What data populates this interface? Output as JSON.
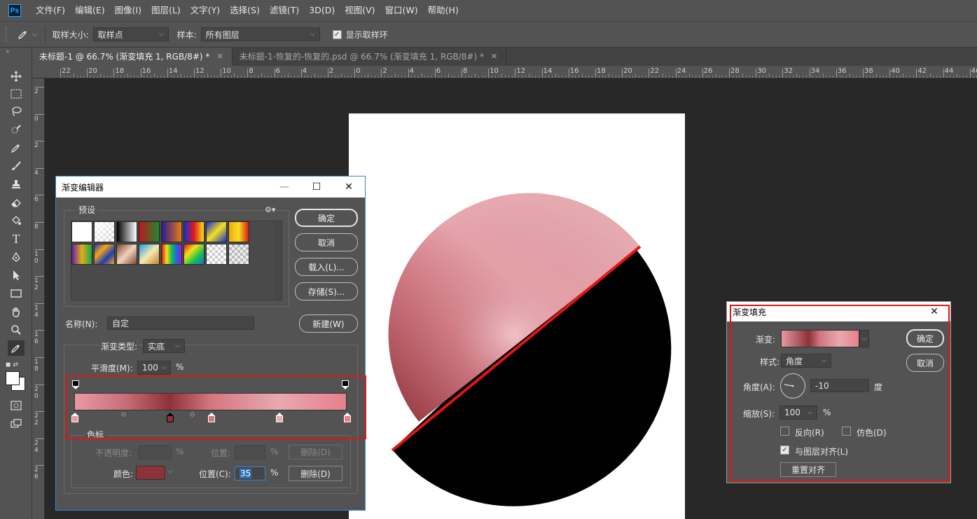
{
  "app": {
    "logo": "Ps"
  },
  "menu": [
    "文件(F)",
    "编辑(E)",
    "图像(I)",
    "图层(L)",
    "文字(Y)",
    "选择(S)",
    "滤镜(T)",
    "3D(D)",
    "视图(V)",
    "窗口(W)",
    "帮助(H)"
  ],
  "options": {
    "sample_size_label": "取样大小:",
    "sample_size_value": "取样点",
    "sample_label": "样本:",
    "sample_value": "所有图层",
    "show_ring_label": "显示取样环",
    "show_ring_checked": true
  },
  "tabs": [
    {
      "label": "未标题-1 @ 66.7% (渐变填充 1, RGB/8#) *",
      "active": true
    },
    {
      "label": "未标题-1-恢复的-恢复的.psd @ 66.7% (渐变填充 1, RGB/8#) *",
      "active": false
    }
  ],
  "ruler_top": [
    "22",
    "20",
    "18",
    "16",
    "14",
    "12",
    "10",
    "8",
    "6",
    "4",
    "2",
    "0",
    "2",
    "4",
    "6",
    "8",
    "10",
    "12",
    "14",
    "16",
    "18",
    "20",
    "22",
    "24",
    "26",
    "28",
    "30",
    "32",
    "34",
    "36",
    "38",
    "40",
    "42",
    "44",
    "46"
  ],
  "ruler_left": [
    "2",
    "0",
    "2",
    "4",
    "6",
    "8",
    "1\n0",
    "1\n2",
    "1\n4",
    "1\n6",
    "1\n8",
    "2\n0",
    "2\n2",
    "2\n4",
    "2\n6"
  ],
  "gradient_editor": {
    "title": "渐变编辑器",
    "presets_label": "预设",
    "ok": "确定",
    "cancel": "取消",
    "load": "载入(L)...",
    "save": "存储(S)...",
    "name_label": "名称(N):",
    "name_value": "自定",
    "new_button": "新建(W)",
    "type_label": "渐变类型:",
    "type_value": "实底",
    "smooth_label": "平滑度(M):",
    "smooth_value": "100",
    "percent": "%",
    "stops_group": "色标",
    "opacity_label": "不透明度:",
    "location_label_dim": "位置:",
    "delete_dim": "删除(D)",
    "color_label": "颜色:",
    "location_label": "位置(C):",
    "location_value": "35",
    "delete": "删除(D)",
    "stop_color": "#8c3238",
    "ramp_colors": [
      "#e79aa3",
      "#c9707a",
      "#8c3238",
      "#d47680",
      "#e8a9b0",
      "#e6808c"
    ]
  },
  "gradient_fill": {
    "title": "渐变填充",
    "gradient_label": "渐变:",
    "style_label": "样式:",
    "style_value": "角度",
    "angle_label": "角度(A):",
    "angle_value": "-10",
    "degree": "度",
    "scale_label": "缩放(S):",
    "scale_value": "100",
    "percent": "%",
    "reverse_label": "反向(R)",
    "reverse_checked": false,
    "dither_label": "仿色(D)",
    "dither_checked": false,
    "align_label": "与图层对齐(L)",
    "align_checked": true,
    "reset_align": "重置对齐",
    "ok": "确定",
    "cancel": "取消"
  },
  "colors": {
    "accent_red": "#e01616",
    "ui_gray": "#535353",
    "dark_bg": "#282828",
    "dialog_border": "#2d87d6"
  }
}
